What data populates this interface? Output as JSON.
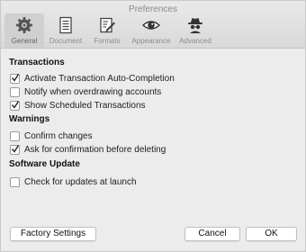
{
  "window": {
    "title": "Preferences"
  },
  "toolbar": {
    "items": [
      {
        "label": "General",
        "icon": "gear-icon",
        "selected": true
      },
      {
        "label": "Document",
        "icon": "document-icon",
        "selected": false
      },
      {
        "label": "Formats",
        "icon": "formats-icon",
        "selected": false
      },
      {
        "label": "Appearance",
        "icon": "eye-icon",
        "selected": false
      },
      {
        "label": "Advanced",
        "icon": "spy-icon",
        "selected": false
      }
    ]
  },
  "sections": [
    {
      "title": "Transactions",
      "options": [
        {
          "label": "Activate Transaction Auto-Completion",
          "checked": true
        },
        {
          "label": "Notify when overdrawing accounts",
          "checked": false
        },
        {
          "label": "Show Scheduled Transactions",
          "checked": true
        }
      ]
    },
    {
      "title": "Warnings",
      "options": [
        {
          "label": "Confirm changes",
          "checked": false
        },
        {
          "label": "Ask for confirmation before deleting",
          "checked": true
        }
      ]
    },
    {
      "title": "Software Update",
      "options": [
        {
          "label": "Check for updates at launch",
          "checked": false
        }
      ]
    }
  ],
  "buttons": {
    "factory": "Factory Settings",
    "cancel": "Cancel",
    "ok": "OK"
  }
}
